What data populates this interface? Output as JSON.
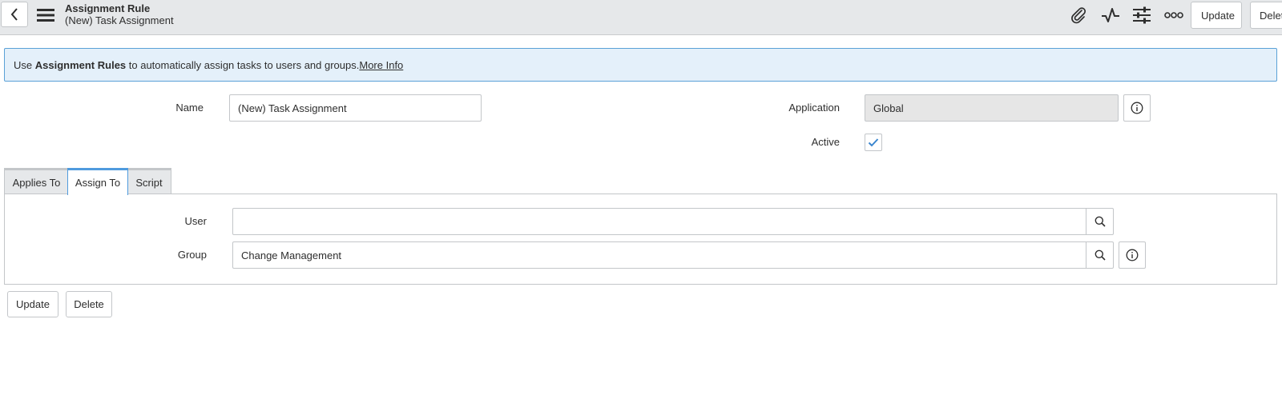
{
  "header": {
    "title": "Assignment Rule",
    "subtitle": "(New) Task Assignment",
    "update_label": "Update",
    "delete_label": "Delet"
  },
  "banner": {
    "prefix": "Use ",
    "bold": "Assignment Rules",
    "middle": " to automatically assign tasks to users and groups.",
    "link": "More Info"
  },
  "form": {
    "name_label": "Name",
    "name_value": "(New) Task Assignment",
    "application_label": "Application",
    "application_value": "Global",
    "active_label": "Active",
    "active_checked": true
  },
  "tabs": [
    {
      "label": "Applies To",
      "active": false
    },
    {
      "label": "Assign To",
      "active": true
    },
    {
      "label": "Script",
      "active": false
    }
  ],
  "assign_to": {
    "user_label": "User",
    "user_value": "",
    "group_label": "Group",
    "group_value": "Change Management"
  },
  "footer": {
    "update_label": "Update",
    "delete_label": "Delete"
  },
  "icons": {
    "back": "chevron-left-icon",
    "menu": "hamburger-icon",
    "attachment": "paperclip-icon",
    "activity": "pulse-icon",
    "personalize": "sliders-icon",
    "more": "more-options-icon",
    "info": "info-icon",
    "search": "search-icon",
    "check": "check-icon"
  },
  "colors": {
    "accent": "#4f9bde",
    "banner_bg": "#e4f0fa",
    "header_bg": "#e6e8ea"
  }
}
